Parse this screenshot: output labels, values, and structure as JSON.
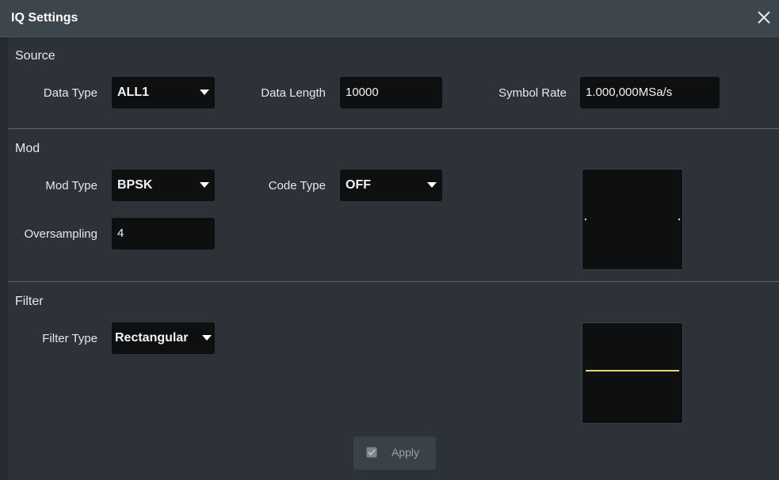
{
  "dialog": {
    "title": "IQ Settings"
  },
  "source": {
    "heading": "Source",
    "data_type_label": "Data Type",
    "data_type_value": "ALL1",
    "data_length_label": "Data Length",
    "data_length_value": "10000",
    "symbol_rate_label": "Symbol Rate",
    "symbol_rate_value": "1.000,000MSa/s"
  },
  "mod": {
    "heading": "Mod",
    "mod_type_label": "Mod Type",
    "mod_type_value": "BPSK",
    "code_type_label": "Code Type",
    "code_type_value": "OFF",
    "oversampling_label": "Oversampling",
    "oversampling_value": "4"
  },
  "filter": {
    "heading": "Filter",
    "filter_type_label": "Filter Type",
    "filter_type_value": "Rectangular"
  },
  "footer": {
    "apply_label": "Apply"
  },
  "colors": {
    "background": "#2c3238",
    "titlebar": "#3d454d",
    "field": "#0d0f11",
    "filter_trace": "#e6d77a"
  },
  "icons": {
    "close": "close-icon",
    "dropdown": "caret-down-icon",
    "apply": "check-icon"
  }
}
